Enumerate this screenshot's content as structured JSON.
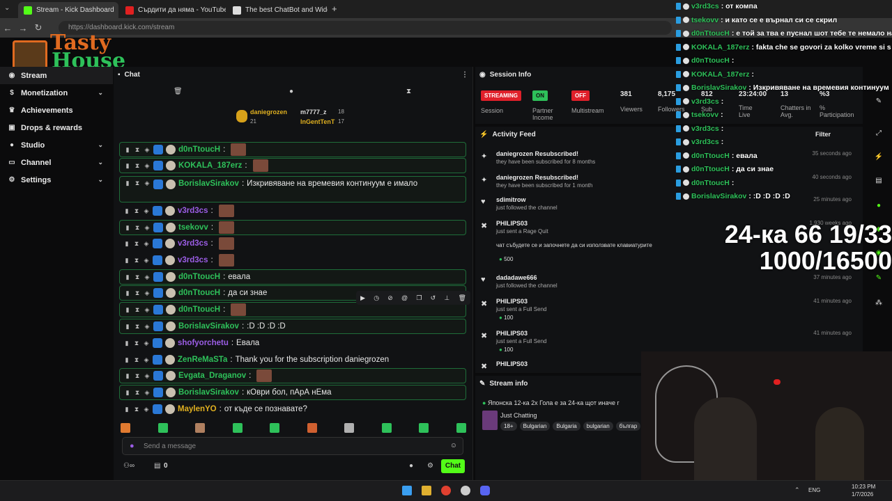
{
  "browser": {
    "tabs": [
      "Stream - Kick Dashboard",
      "Сърдити да няма - YouTube",
      "The best ChatBot and Widgets"
    ],
    "url": "https://dashboard.kick.com/stream"
  },
  "logo": {
    "line1": "Tasty",
    "line2": "House"
  },
  "sidebar": {
    "items": [
      {
        "label": "Stream",
        "icon": "stream-icon"
      },
      {
        "label": "Monetization",
        "icon": "dollar-icon"
      },
      {
        "label": "Achievements",
        "icon": "trophy-icon"
      },
      {
        "label": "Drops & rewards",
        "icon": "gift-icon"
      },
      {
        "label": "Studio",
        "icon": "studio-icon"
      },
      {
        "label": "Channel",
        "icon": "channel-icon"
      },
      {
        "label": "Settings",
        "icon": "gear-icon"
      }
    ]
  },
  "chat": {
    "title": "Chat",
    "pinned": [
      {
        "name": "daniegrozen",
        "count": "21"
      },
      {
        "name": "m7777_z",
        "count": "18"
      },
      {
        "name": "InGentTenT",
        "count": "17"
      }
    ],
    "messages": [
      {
        "user": "d0nTtoucH",
        "text": "",
        "color": "#2ec15a"
      },
      {
        "user": "KOKALA_187erz",
        "text": "",
        "color": "#2ec15a"
      },
      {
        "user": "BorislavSirakov",
        "text": "Изкривяване на времевия континуум е имало",
        "color": "#2ec15a"
      },
      {
        "user": "v3rd3cs",
        "text": "",
        "color": "#9b5de5"
      },
      {
        "user": "tsekovv",
        "text": "",
        "color": "#2ec15a"
      },
      {
        "user": "v3rd3cs",
        "text": "",
        "color": "#9b5de5"
      },
      {
        "user": "v3rd3cs",
        "text": "",
        "color": "#9b5de5"
      },
      {
        "user": "d0nTtoucH",
        "text": "евала",
        "color": "#2ec15a"
      },
      {
        "user": "d0nTtoucH",
        "text": "да си знае",
        "color": "#2ec15a"
      },
      {
        "user": "d0nTtoucH",
        "text": "",
        "color": "#2ec15a"
      },
      {
        "user": "BorislavSirakov",
        "text": ":D :D :D :D",
        "color": "#2ec15a"
      },
      {
        "user": "shofyorchetu",
        "text": "Евала",
        "color": "#9b5de5"
      },
      {
        "user": "ZenReMaSTa",
        "text": "Thank you for the subscription daniegrozen",
        "color": "#2ec15a"
      },
      {
        "user": "Evgata_Draganov",
        "text": "",
        "color": "#2ec15a"
      },
      {
        "user": "BorislavSirakov",
        "text": "кОври бол, пАрА нЕма",
        "color": "#2ec15a"
      },
      {
        "user": "MaylenYO",
        "text": "от къде се познавате?",
        "color": "#e0b020"
      }
    ],
    "input_placeholder": "Send a message",
    "viewers_count": "0",
    "chat_button": "Chat"
  },
  "session": {
    "title": "Session Info",
    "tiles": [
      {
        "value": "STREAMING",
        "label": "Session"
      },
      {
        "value": "ON",
        "label": "Partner Income"
      },
      {
        "value": "OFF",
        "label": "Multistream"
      },
      {
        "value": "381",
        "label": "Viewers"
      },
      {
        "value": "8,175",
        "label": "Followers"
      },
      {
        "value": "812",
        "label": "Sub"
      },
      {
        "value": "23:24:00",
        "label": "Time Live"
      },
      {
        "value": "13",
        "label": "Chatters in Avg."
      },
      {
        "value": "%3",
        "label": "% Participation"
      }
    ]
  },
  "activity": {
    "title": "Activity Feed",
    "filter": "Filter",
    "items": [
      {
        "name": "daniegrozen Resubscribed!",
        "sub": "they have been subscribed for 8 months",
        "time": "35 seconds ago"
      },
      {
        "name": "daniegrozen Resubscribed!",
        "sub": "they have been subscribed for 1 month",
        "time": "40 seconds ago"
      },
      {
        "name": "sdimitrow",
        "sub": "just followed the channel",
        "time": "25 minutes ago"
      },
      {
        "name": "PHILIPS03",
        "sub": "just sent a Rage Quit",
        "time": "1,930 weeks ago"
      },
      {
        "name": "dadadawe666",
        "sub": "just followed the channel",
        "time": "37 minutes ago"
      },
      {
        "name": "PHILIPS03",
        "sub": "just sent a Full Send",
        "time": "41 minutes ago"
      },
      {
        "name": "PHILIPS03",
        "sub": "just sent a Full Send",
        "time": "41 minutes ago"
      },
      {
        "name": "PHILIPS03",
        "sub": "",
        "time": ""
      }
    ],
    "rage_note": "чат събудете се и започнете да си използвате клавиатурите",
    "amounts": [
      "500",
      "100",
      "100"
    ]
  },
  "stream_info": {
    "title": "Stream info",
    "stream_title": "Японска 12-ка 2х Гола е за 24-ка щот иначе г",
    "category": "Just Chatting",
    "tags": [
      "18+",
      "Bulgarian",
      "Bulgaria",
      "bulgarian",
      "българ"
    ]
  },
  "overlay_chat": [
    {
      "user": "v3rd3cs",
      "text": ": от компа"
    },
    {
      "user": "tsekovv",
      "text": ": и като се е върнал си се скрил"
    },
    {
      "user": "d0nTtoucH",
      "text": ": е той за тва е пуснал шот тебе те немало на"
    },
    {
      "user": "KOKALA_187erz",
      "text": ": fakta che se govori za kolko vreme si s"
    },
    {
      "user": "d0nTtoucH",
      "text": ":"
    },
    {
      "user": "KOKALA_187erz",
      "text": ":"
    },
    {
      "user": "BorislavSirakov",
      "text": ": Изкривяване на времевия континуум"
    },
    {
      "user": "v3rd3cs",
      "text": ":"
    },
    {
      "user": "tsekovv",
      "text": ":"
    },
    {
      "user": "v3rd3cs",
      "text": ":"
    },
    {
      "user": "v3rd3cs",
      "text": ":"
    },
    {
      "user": "d0nTtoucH",
      "text": ": евала"
    },
    {
      "user": "d0nTtoucH",
      "text": ": да си знае"
    },
    {
      "user": "d0nTtoucH",
      "text": ":"
    },
    {
      "user": "BorislavSirakov",
      "text": ": :D :D :D :D"
    }
  ],
  "overlay_big": {
    "line1": "24-ка 66 19/33",
    "line2": "1000/16500"
  },
  "taskbar": {
    "lang": "ENG",
    "time": "10:23 PM",
    "date": "1/7/2026"
  }
}
